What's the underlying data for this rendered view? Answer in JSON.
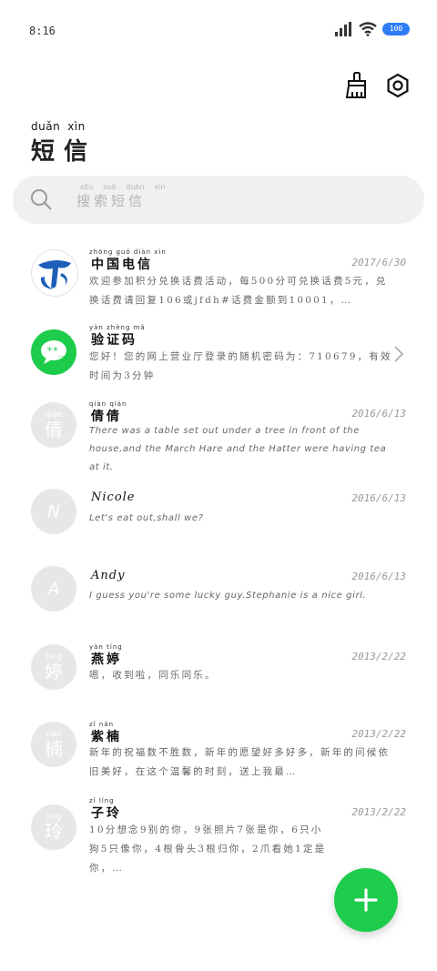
{
  "status_bar": {
    "time": "8:16",
    "battery": "100"
  },
  "header": {
    "title_pinyin": [
      "duǎn",
      "xìn"
    ],
    "title": "短信"
  },
  "search": {
    "placeholder_pinyin": [
      "sōu",
      "suǒ",
      "duǎn",
      "xìn"
    ],
    "placeholder": "搜索短信"
  },
  "messages": [
    {
      "sender_pinyin": "zhōng guó diàn xìn",
      "sender": "中国电信",
      "date": "2017/6/30",
      "preview": "欢迎参加积分兑换话费活动，每500分可兑换话费5元，兑换话费请回复106或jfdh#话费金额到10001，…",
      "avatar": "telecom"
    },
    {
      "sender_pinyin": "yàn zhèng mǎ",
      "sender": "验证码",
      "date": "",
      "preview": "您好！您的网上营业厅登录的随机密码为：710679，有效时间为3分钟",
      "avatar": "sms"
    },
    {
      "sender_pinyin": "qiàn qiàn",
      "sender": "倩倩",
      "date": "2016/6/13",
      "avatar_py": "qiàn",
      "avatar_char": "倩",
      "preview": "There was a table set out under a tree in front of the house,and the March Hare and the Hatter were having tea at it."
    },
    {
      "sender": "Nicole",
      "date": "2016/6/13",
      "avatar_letter": "N",
      "preview": "Let's eat out,shall we?"
    },
    {
      "sender": "Andy",
      "date": "2016/6/13",
      "avatar_letter": "A",
      "preview": "I guess you're some lucky guy.Stephanie is a nice girl."
    },
    {
      "sender_pinyin": "yàn tíng",
      "sender": "燕婷",
      "date": "2013/2/22",
      "avatar_py": "tíng",
      "avatar_char": "婷",
      "preview": "嗯，收到啦，同乐同乐。"
    },
    {
      "sender_pinyin": "zǐ nán",
      "sender": "紫楠",
      "date": "2013/2/22",
      "avatar_py": "nán",
      "avatar_char": "楠",
      "preview": "新年的祝福数不胜数，新年的愿望好多好多，新年的问候依旧美好，在这个温馨的时刻，送上我最…"
    },
    {
      "sender_pinyin": "zǐ líng",
      "sender": "子玲",
      "date": "2013/2/22",
      "avatar_py": "líng",
      "avatar_char": "玲",
      "preview": "10分想念9别的你，9张照片7张是你，6只小狗5只像你，4根骨头3根归你，2爪看她1定是你，…"
    }
  ],
  "colors": {
    "accent": "#1ecc4c",
    "telecom_blue": "#1d5fb8",
    "battery": "#2f7cf6"
  },
  "icons": [
    "signal-icon",
    "wifi-icon",
    "brush-icon",
    "settings-icon",
    "search-icon",
    "chevron-right-icon",
    "plus-icon"
  ]
}
